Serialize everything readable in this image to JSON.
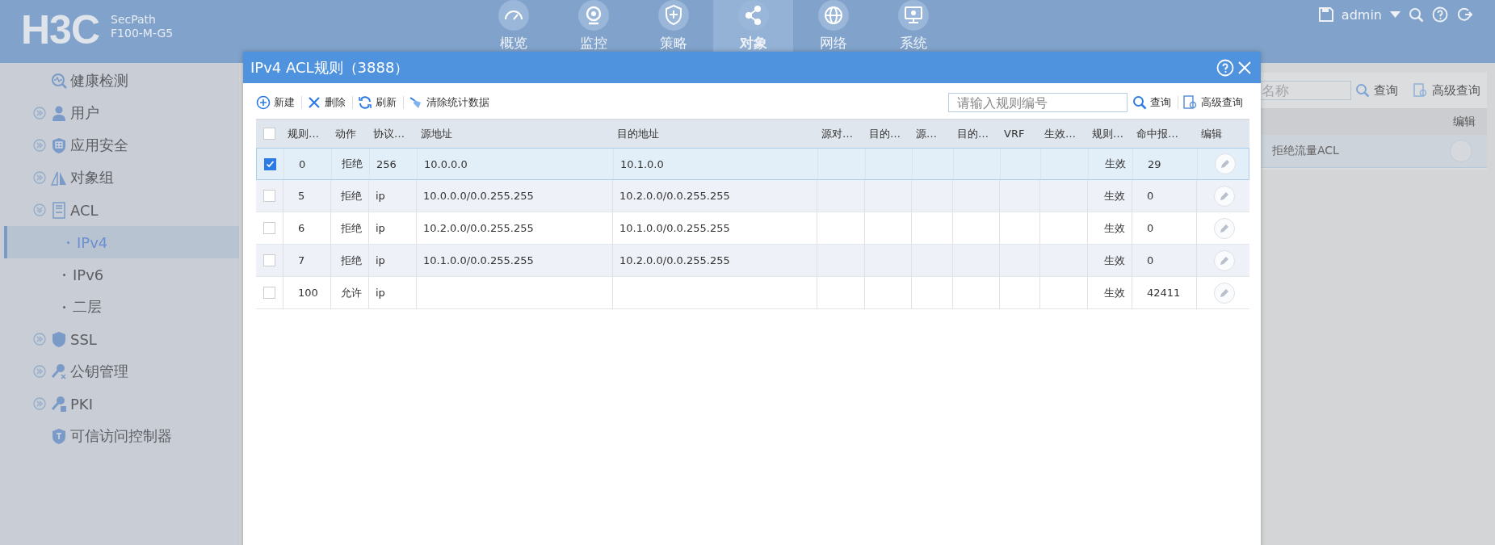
{
  "header": {
    "logo": "H3C",
    "product": "SecPath",
    "model": "F100-M-G5",
    "nav": [
      {
        "label": "概览",
        "selected": false
      },
      {
        "label": "监控",
        "selected": false
      },
      {
        "label": "策略",
        "selected": false
      },
      {
        "label": "对象",
        "selected": true
      },
      {
        "label": "网络",
        "selected": false
      },
      {
        "label": "系统",
        "selected": false
      }
    ],
    "user": "admin"
  },
  "sidebar": {
    "items": [
      {
        "label": "健康检测",
        "selected": false
      },
      {
        "label": "用户",
        "selected": false,
        "expanded": false
      },
      {
        "label": "应用安全",
        "selected": false,
        "expanded": false
      },
      {
        "label": "对象组",
        "selected": false,
        "expanded": false
      },
      {
        "label": "ACL",
        "selected": false,
        "expanded": true,
        "children": [
          {
            "label": "IPv4",
            "selected": true
          },
          {
            "label": "IPv6",
            "selected": false
          },
          {
            "label": "二层",
            "selected": false
          }
        ]
      },
      {
        "label": "SSL",
        "selected": false,
        "expanded": false
      },
      {
        "label": "公钥管理",
        "selected": false,
        "expanded": false
      },
      {
        "label": "PKI",
        "selected": false,
        "expanded": false
      },
      {
        "label": "可信访问控制器",
        "selected": false
      }
    ]
  },
  "background": {
    "search_placeholder": "名称",
    "search_button": "查询",
    "advanced_button": "高级查询",
    "column": "编辑",
    "row_text": "拒绝流量ACL"
  },
  "dialog": {
    "title": "IPv4 ACL规则（3888）",
    "toolbar": [
      "新建",
      "删除",
      "刷新",
      "清除统计数据"
    ],
    "search_placeholder": "请输入规则编号",
    "search_button": "查询",
    "advanced_button": "高级查询",
    "select_all": {
      "checked": false
    },
    "columns": [
      "规则…",
      "动作",
      "协议…",
      "源地址",
      "目的地址",
      "源对…",
      "目的…",
      "源…",
      "目的…",
      "VRF",
      "生效…",
      "规则…",
      "命中报…",
      "编辑"
    ],
    "rows": [
      {
        "selected": true,
        "rule": "0",
        "action": "拒绝",
        "protocol": "256",
        "source": "10.0.0.0",
        "destination": "10.1.0.0",
        "status": "生效",
        "hits": "29"
      },
      {
        "selected": false,
        "rule": "5",
        "action": "拒绝",
        "protocol": "ip",
        "source": "10.0.0.0/0.0.255.255",
        "destination": "10.2.0.0/0.0.255.255",
        "status": "生效",
        "hits": "0"
      },
      {
        "selected": false,
        "rule": "6",
        "action": "拒绝",
        "protocol": "ip",
        "source": "10.2.0.0/0.0.255.255",
        "destination": "10.1.0.0/0.0.255.255",
        "status": "生效",
        "hits": "0"
      },
      {
        "selected": false,
        "rule": "7",
        "action": "拒绝",
        "protocol": "ip",
        "source": "10.1.0.0/0.0.255.255",
        "destination": "10.2.0.0/0.0.255.255",
        "status": "生效",
        "hits": "0"
      },
      {
        "selected": false,
        "rule": "100",
        "action": "允许",
        "protocol": "ip",
        "status": "生效",
        "hits": "42411"
      }
    ]
  }
}
